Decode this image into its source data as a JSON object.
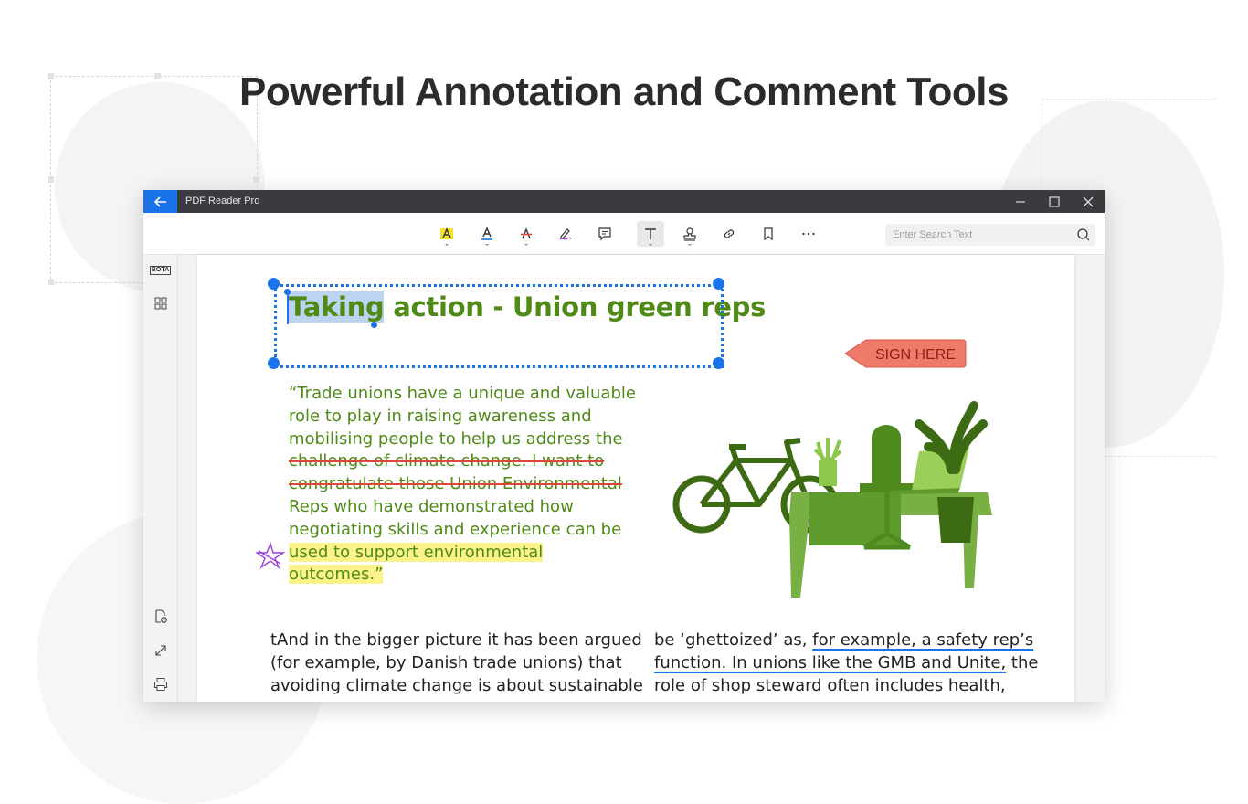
{
  "headline": "Powerful Annotation and Comment Tools",
  "window": {
    "title": "PDF Reader Pro"
  },
  "toolbar": {
    "tools": [
      {
        "name": "highlight-tool",
        "icon": "highlight-icon"
      },
      {
        "name": "underline-tool",
        "icon": "underline-icon"
      },
      {
        "name": "strikethrough-tool",
        "icon": "strikethrough-icon"
      },
      {
        "name": "freehand-tool",
        "icon": "pen-icon"
      },
      {
        "name": "note-tool",
        "icon": "comment-icon"
      },
      {
        "name": "text-box-tool",
        "icon": "text-icon",
        "active": true
      },
      {
        "name": "stamp-tool",
        "icon": "stamp-icon"
      },
      {
        "name": "link-tool",
        "icon": "link-icon"
      },
      {
        "name": "bookmark-tool",
        "icon": "bookmark-icon"
      },
      {
        "name": "more-tool",
        "icon": "more-icon"
      }
    ],
    "search_placeholder": "Enter Search Text"
  },
  "sidebar": {
    "top_items": [
      {
        "label": "BOTA",
        "icon": "bota-icon"
      },
      {
        "icon": "thumbnails-icon"
      }
    ],
    "bottom_items": [
      {
        "icon": "file-settings-icon"
      },
      {
        "icon": "fullscreen-icon"
      },
      {
        "icon": "print-icon"
      }
    ]
  },
  "document": {
    "title_selected": "Taking",
    "title_rest": " action - Union green reps",
    "quote_lines": [
      {
        "text": "“Trade unions have a unique and valuable",
        "style": "normal"
      },
      {
        "text": "role to play in raising awareness and",
        "style": "normal"
      },
      {
        "text": "mobilising people to help us address the",
        "style": "normal"
      },
      {
        "text": "challenge of climate change. I want to",
        "style": "strike"
      },
      {
        "text": "congratulate those Union Environmental",
        "style": "strike"
      },
      {
        "text": "Reps who have demonstrated how",
        "style": "normal"
      },
      {
        "text": "negotiating skills and experience can be",
        "style": "normal"
      },
      {
        "text": "used to support environmental",
        "style": "highlight"
      },
      {
        "text": "outcomes.”",
        "style": "highlight"
      }
    ],
    "stamp_text": "SIGN HERE",
    "left_column": [
      "tAnd in the bigger picture it has been argued",
      "(for example, by Danish trade unions) that",
      "avoiding climate change is about sustainable"
    ],
    "right_column": {
      "line1_plain": "be ‘ghettoized’ as, ",
      "line1_underlined": "for example, a safety rep’s",
      "line2_underlined": "function. In unions like the GMB and Unite,",
      "line2_plain": " the",
      "line3_plain": "role of shop steward often includes health,"
    }
  },
  "colors": {
    "accent": "#1a73e8",
    "title_bar": "#3a3b3f",
    "doc_green": "#4f8a17",
    "strike_red": "#e0453c",
    "highlight_yellow": "#fbf28a",
    "stamp_red": "#ef7a6a",
    "freehand_purple": "#9b3fd6"
  }
}
